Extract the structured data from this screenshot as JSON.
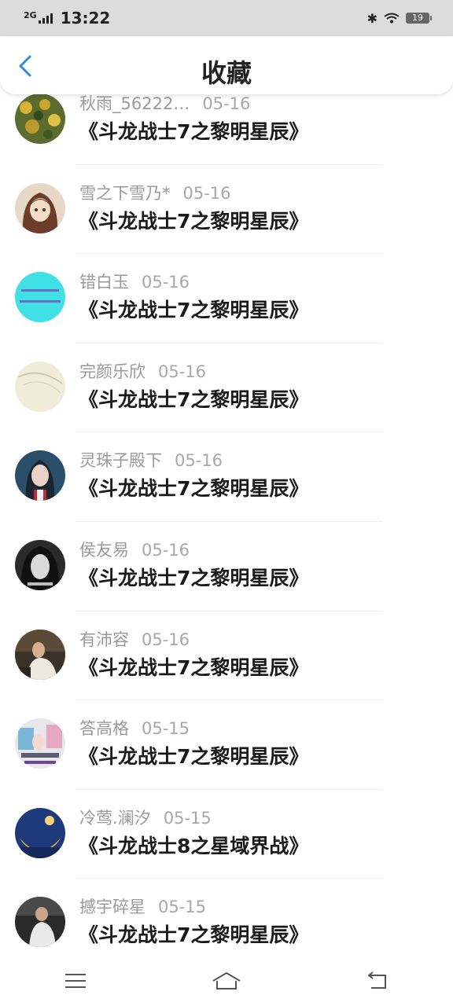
{
  "status": {
    "network": "2G",
    "time": "13:22",
    "battery": "19"
  },
  "header": {
    "title": "收藏"
  },
  "items": [
    {
      "user": "秋雨_56222…",
      "date": "05-16",
      "book": "《斗龙战士7之黎明星辰》"
    },
    {
      "user": "雪之下雪乃*",
      "date": "05-16",
      "book": "《斗龙战士7之黎明星辰》"
    },
    {
      "user": "错白玉",
      "date": "05-16",
      "book": "《斗龙战士7之黎明星辰》"
    },
    {
      "user": "完颜乐欣",
      "date": "05-16",
      "book": "《斗龙战士7之黎明星辰》"
    },
    {
      "user": "灵珠子殿下",
      "date": "05-16",
      "book": "《斗龙战士7之黎明星辰》"
    },
    {
      "user": "侯友易",
      "date": "05-16",
      "book": "《斗龙战士7之黎明星辰》"
    },
    {
      "user": "有沛容",
      "date": "05-16",
      "book": "《斗龙战士7之黎明星辰》"
    },
    {
      "user": "答高格",
      "date": "05-15",
      "book": "《斗龙战士7之黎明星辰》"
    },
    {
      "user": "冷莺.澜汐",
      "date": "05-15",
      "book": "《斗龙战士8之星域界战》"
    },
    {
      "user": "撼宇碎星",
      "date": "05-15",
      "book": "《斗龙战士7之黎明星辰》"
    }
  ],
  "colors": {
    "accent": "#2a8ee0",
    "meta_text": "#9a9a9a",
    "title_text": "#1a1a1a"
  },
  "icons": {
    "back": "chevron-left-icon",
    "menu": "menu-icon",
    "home": "home-icon",
    "return": "return-icon"
  }
}
